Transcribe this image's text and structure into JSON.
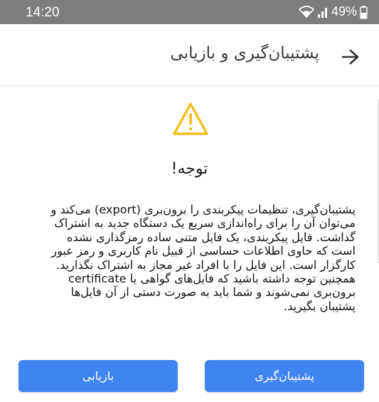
{
  "status_bar": {
    "time": "14:20",
    "battery": "49%",
    "icons": [
      "wifi-icon",
      "signal-icon",
      "battery-icon"
    ]
  },
  "app_bar": {
    "title": "پشتیبان‌گیری و بازیابی",
    "back_icon": "arrow-right-icon"
  },
  "alert": {
    "icon": "warning-icon",
    "icon_color": "#f5bd1f",
    "title": "توجه!",
    "body_lines": [
      "پشتیبان‌گیری، تنظیمات پیکربندی را برون‌بری (export) می‌کند و",
      "می‌توان آن را برای راه‌اندازی سریع یک دستگاه جدید به اشتراک",
      "گذاشت. فایل پیکربندی، یک فایل متنی ساده رمزگذاری نشده",
      "است که حاوی اطلاعات حساسی از قبیل نام کاربری و رمز عبور",
      "کارگزار است. این فایل را با افراد غیر مجاز به اشتراک نگذارید.",
      "همچنین توجه داشته باشید که فایل‌های گواهی یا certificate",
      "برون‌بری نمی‌شوند و شما باید به صورت دستی از آن فایل‌ها",
      "پشتیبان بگیرید."
    ]
  },
  "buttons": {
    "backup_label": "پشتیبان‌گیری",
    "restore_label": "بازیابی",
    "color": "#3f85f2"
  }
}
